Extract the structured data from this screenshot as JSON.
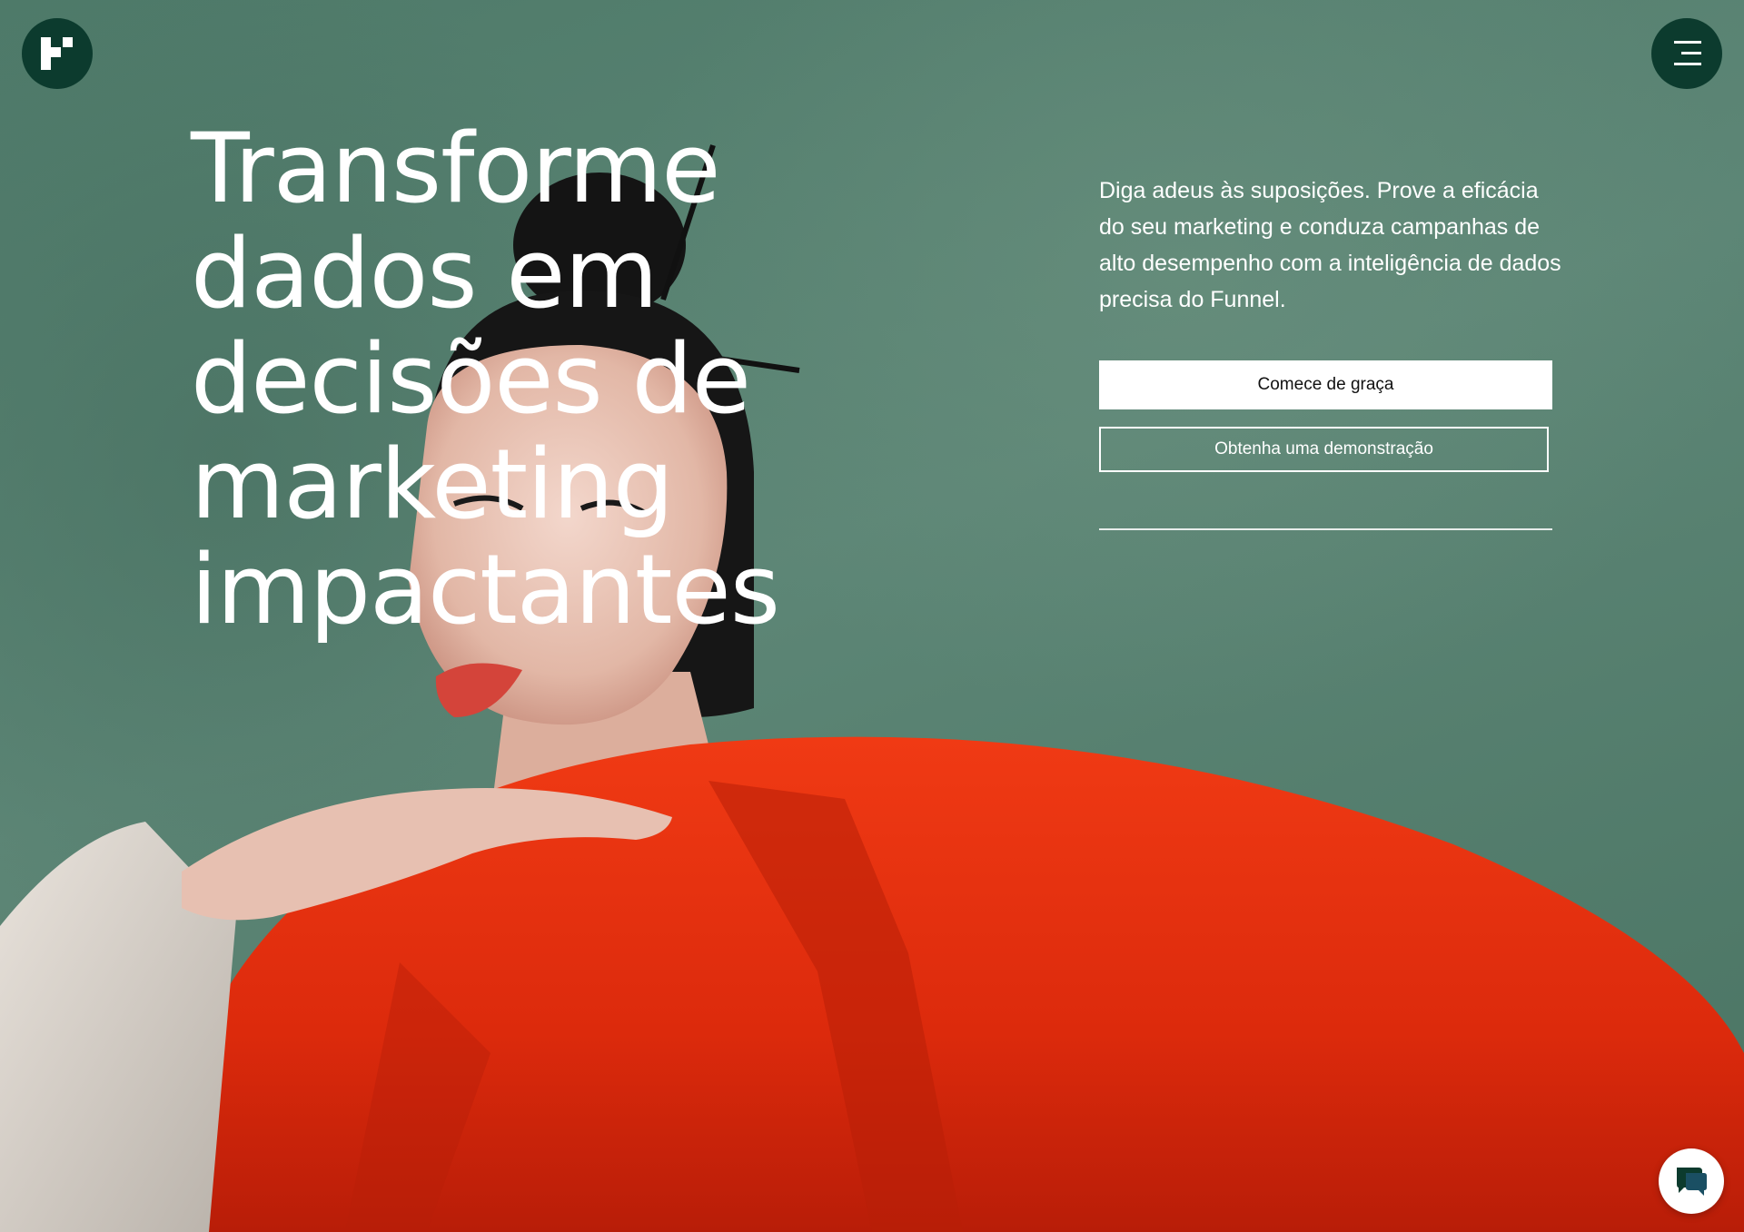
{
  "header": {
    "logo_icon": "funnel-logo-icon",
    "menu_icon": "hamburger-menu-icon"
  },
  "hero": {
    "headline": "Transforme dados em decisões de marketing impactantes",
    "tagline": "Diga adeus às suposições. Prove a eficácia do seu marketing e conduza campanhas de alto desempenho com a inteligência de dados precisa do Funnel.",
    "primary_cta": "Comece de graça",
    "secondary_cta": "Obtenha uma demonstração"
  },
  "chat": {
    "icon": "chat-bubbles-icon"
  },
  "colors": {
    "background_green": "#5a8473",
    "logo_dark_green": "#0c3b2e",
    "jacket_red": "#e0300f",
    "white": "#ffffff"
  }
}
